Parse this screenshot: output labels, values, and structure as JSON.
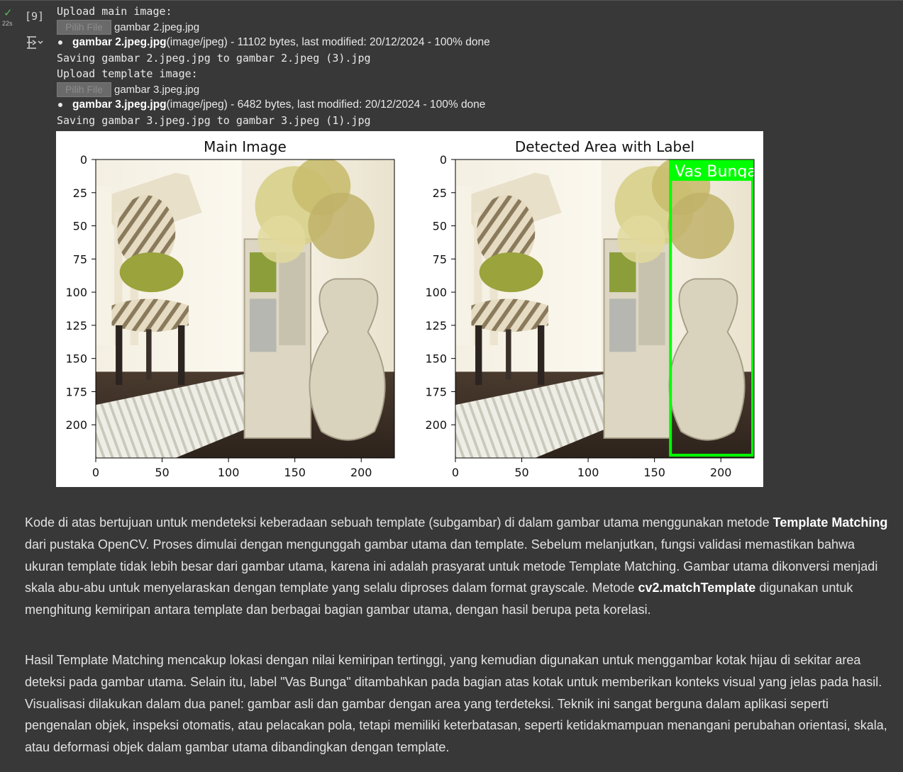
{
  "cell": {
    "status_icon": "check-icon",
    "duration": "22s",
    "execution_count": "[9]",
    "output_icon": "output-toggle-icon"
  },
  "output": {
    "upload_main_label": "Upload main image:",
    "file_button_label": "Pilih File",
    "main_file_name": "gambar 2.jpeg.jpg",
    "main_file_info_name": "gambar 2.jpeg.jpg",
    "main_file_info_detail": "(image/jpeg) - 11102 bytes, last modified: 20/12/2024 - 100% done",
    "main_saving": "Saving gambar 2.jpeg.jpg to gambar 2.jpeg (3).jpg",
    "upload_template_label": "Upload template image:",
    "template_file_name": "gambar 3.jpeg.jpg",
    "template_file_info_name": "gambar 3.jpeg.jpg",
    "template_file_info_detail": "(image/jpeg) - 6482 bytes, last modified: 20/12/2024 - 100% done",
    "template_saving": "Saving gambar 3.jpeg.jpg to gambar 3.jpeg (1).jpg"
  },
  "chart_data": [
    {
      "type": "image",
      "title": "Main Image",
      "x_ticks": [
        "0",
        "50",
        "100",
        "150",
        "200"
      ],
      "y_ticks": [
        "0",
        "25",
        "50",
        "75",
        "100",
        "125",
        "150",
        "175",
        "200"
      ],
      "xlim": [
        0,
        225
      ],
      "ylim": [
        225,
        0
      ]
    },
    {
      "type": "image",
      "title": "Detected Area with Label",
      "x_ticks": [
        "0",
        "50",
        "100",
        "150",
        "200"
      ],
      "y_ticks": [
        "0",
        "25",
        "50",
        "75",
        "100",
        "125",
        "150",
        "175",
        "200"
      ],
      "xlim": [
        0,
        225
      ],
      "ylim": [
        225,
        0
      ],
      "detection_box": {
        "x1": 161,
        "y1": 15,
        "x2": 225,
        "y2": 224,
        "color": "#00ff00"
      },
      "detection_label": "Vas Bunga"
    }
  ],
  "markdown": {
    "p1_a": "Kode di atas bertujuan untuk mendeteksi keberadaan sebuah template (subgambar) di dalam gambar utama menggunakan metode ",
    "p1_b1": "Template Matching",
    "p1_c": " dari pustaka OpenCV. Proses dimulai dengan mengunggah gambar utama dan template. Sebelum melanjutkan, fungsi validasi memastikan bahwa ukuran template tidak lebih besar dari gambar utama, karena ini adalah prasyarat untuk metode Template Matching. Gambar utama dikonversi menjadi skala abu-abu untuk menyelaraskan dengan template yang selalu diproses dalam format grayscale. Metode ",
    "p1_b2": "cv2.matchTemplate",
    "p1_d": " digunakan untuk menghitung kemiripan antara template dan berbagai bagian gambar utama, dengan hasil berupa peta korelasi.",
    "p2": "Hasil Template Matching mencakup lokasi dengan nilai kemiripan tertinggi, yang kemudian digunakan untuk menggambar kotak hijau di sekitar area deteksi pada gambar utama. Selain itu, label \"Vas Bunga\" ditambahkan pada bagian atas kotak untuk memberikan konteks visual yang jelas pada hasil. Visualisasi dilakukan dalam dua panel: gambar asli dan gambar dengan area yang terdeteksi. Teknik ini sangat berguna dalam aplikasi seperti pengenalan objek, inspeksi otomatis, atau pelacakan pola, tetapi memiliki keterbatasan, seperti ketidakmampuan menangani perubahan orientasi, skala, atau deformasi objek dalam gambar utama dibandingkan dengan template."
  }
}
